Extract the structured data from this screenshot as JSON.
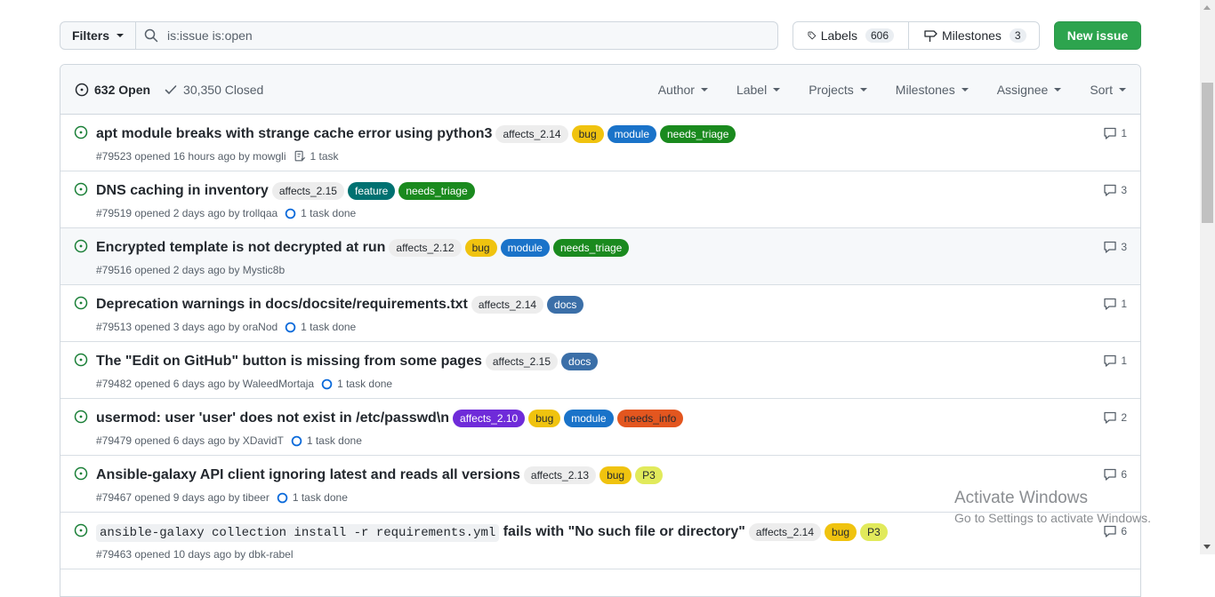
{
  "toolbar": {
    "filters_label": "Filters",
    "search_value": "is:issue is:open",
    "labels_label": "Labels",
    "labels_count": "606",
    "milestones_label": "Milestones",
    "milestones_count": "3",
    "new_issue_label": "New issue"
  },
  "header": {
    "open_label": "632 Open",
    "closed_label": "30,350 Closed",
    "filters": [
      "Author",
      "Label",
      "Projects",
      "Milestones",
      "Assignee",
      "Sort"
    ]
  },
  "issues": [
    {
      "title": "apt module breaks with strange cache error using python3",
      "labels": [
        {
          "text": "affects_2.14",
          "kind": "affects"
        },
        {
          "text": "bug",
          "kind": "bug"
        },
        {
          "text": "module",
          "kind": "module"
        },
        {
          "text": "needs_triage",
          "kind": "triage"
        }
      ],
      "meta": "#79523 opened 16 hours ago by mowgli",
      "task": "1 task",
      "task_icon": "checklist-icon",
      "comments": "1"
    },
    {
      "title": "DNS caching in inventory",
      "labels": [
        {
          "text": "affects_2.15",
          "kind": "affects"
        },
        {
          "text": "feature",
          "kind": "feature"
        },
        {
          "text": "needs_triage",
          "kind": "triage"
        }
      ],
      "meta": "#79519 opened 2 days ago by trollqaa",
      "task": "1 task done",
      "task_icon": "circle-icon",
      "comments": "3"
    },
    {
      "title": "Encrypted template is not decrypted at run",
      "labels": [
        {
          "text": "affects_2.12",
          "kind": "affects"
        },
        {
          "text": "bug",
          "kind": "bug"
        },
        {
          "text": "module",
          "kind": "module"
        },
        {
          "text": "needs_triage",
          "kind": "triage"
        }
      ],
      "meta": "#79516 opened 2 days ago by Mystic8b",
      "task": "",
      "task_icon": "",
      "comments": "3"
    },
    {
      "title": "Deprecation warnings in docs/docsite/requirements.txt",
      "labels": [
        {
          "text": "affects_2.14",
          "kind": "affects"
        },
        {
          "text": "docs",
          "kind": "docs"
        }
      ],
      "meta": "#79513 opened 3 days ago by oraNod",
      "task": "1 task done",
      "task_icon": "circle-icon",
      "comments": "1"
    },
    {
      "title": "The \"Edit on GitHub\" button is missing from some pages",
      "labels": [
        {
          "text": "affects_2.15",
          "kind": "affects"
        },
        {
          "text": "docs",
          "kind": "docs"
        }
      ],
      "meta": "#79482 opened 6 days ago by WaleedMortaja",
      "task": "1 task done",
      "task_icon": "circle-icon",
      "comments": "1"
    },
    {
      "title": "usermod: user 'user' does not exist in /etc/passwd\\n",
      "labels": [
        {
          "text": "affects_2.10",
          "kind": "affects210"
        },
        {
          "text": "bug",
          "kind": "bug"
        },
        {
          "text": "module",
          "kind": "module"
        },
        {
          "text": "needs_info",
          "kind": "info"
        }
      ],
      "meta": "#79479 opened 6 days ago by XDavidT",
      "task": "1 task done",
      "task_icon": "circle-icon",
      "comments": "2"
    },
    {
      "title": "Ansible-galaxy API client ignoring latest and reads all versions",
      "labels": [
        {
          "text": "affects_2.13",
          "kind": "affects"
        },
        {
          "text": "bug",
          "kind": "bug"
        },
        {
          "text": "P3",
          "kind": "p3"
        }
      ],
      "meta": "#79467 opened 9 days ago by tibeer",
      "task": "1 task done",
      "task_icon": "circle-icon",
      "comments": "6"
    },
    {
      "title_code": "ansible-galaxy collection install -r requirements.yml",
      "title": " fails with \"No such file or directory\"",
      "labels": [
        {
          "text": "affects_2.14",
          "kind": "affects"
        },
        {
          "text": "bug",
          "kind": "bug"
        },
        {
          "text": "P3",
          "kind": "p3"
        }
      ],
      "meta": "#79463 opened 10 days ago by dbk-rabel",
      "task": "",
      "task_icon": "",
      "comments": "6"
    }
  ],
  "watermark": {
    "title": "Activate Windows",
    "subtitle": "Go to Settings to activate Windows."
  },
  "colors": {
    "primary_button": "#2da44e",
    "open_icon": "#1a7f37",
    "border": "#d0d7de"
  }
}
